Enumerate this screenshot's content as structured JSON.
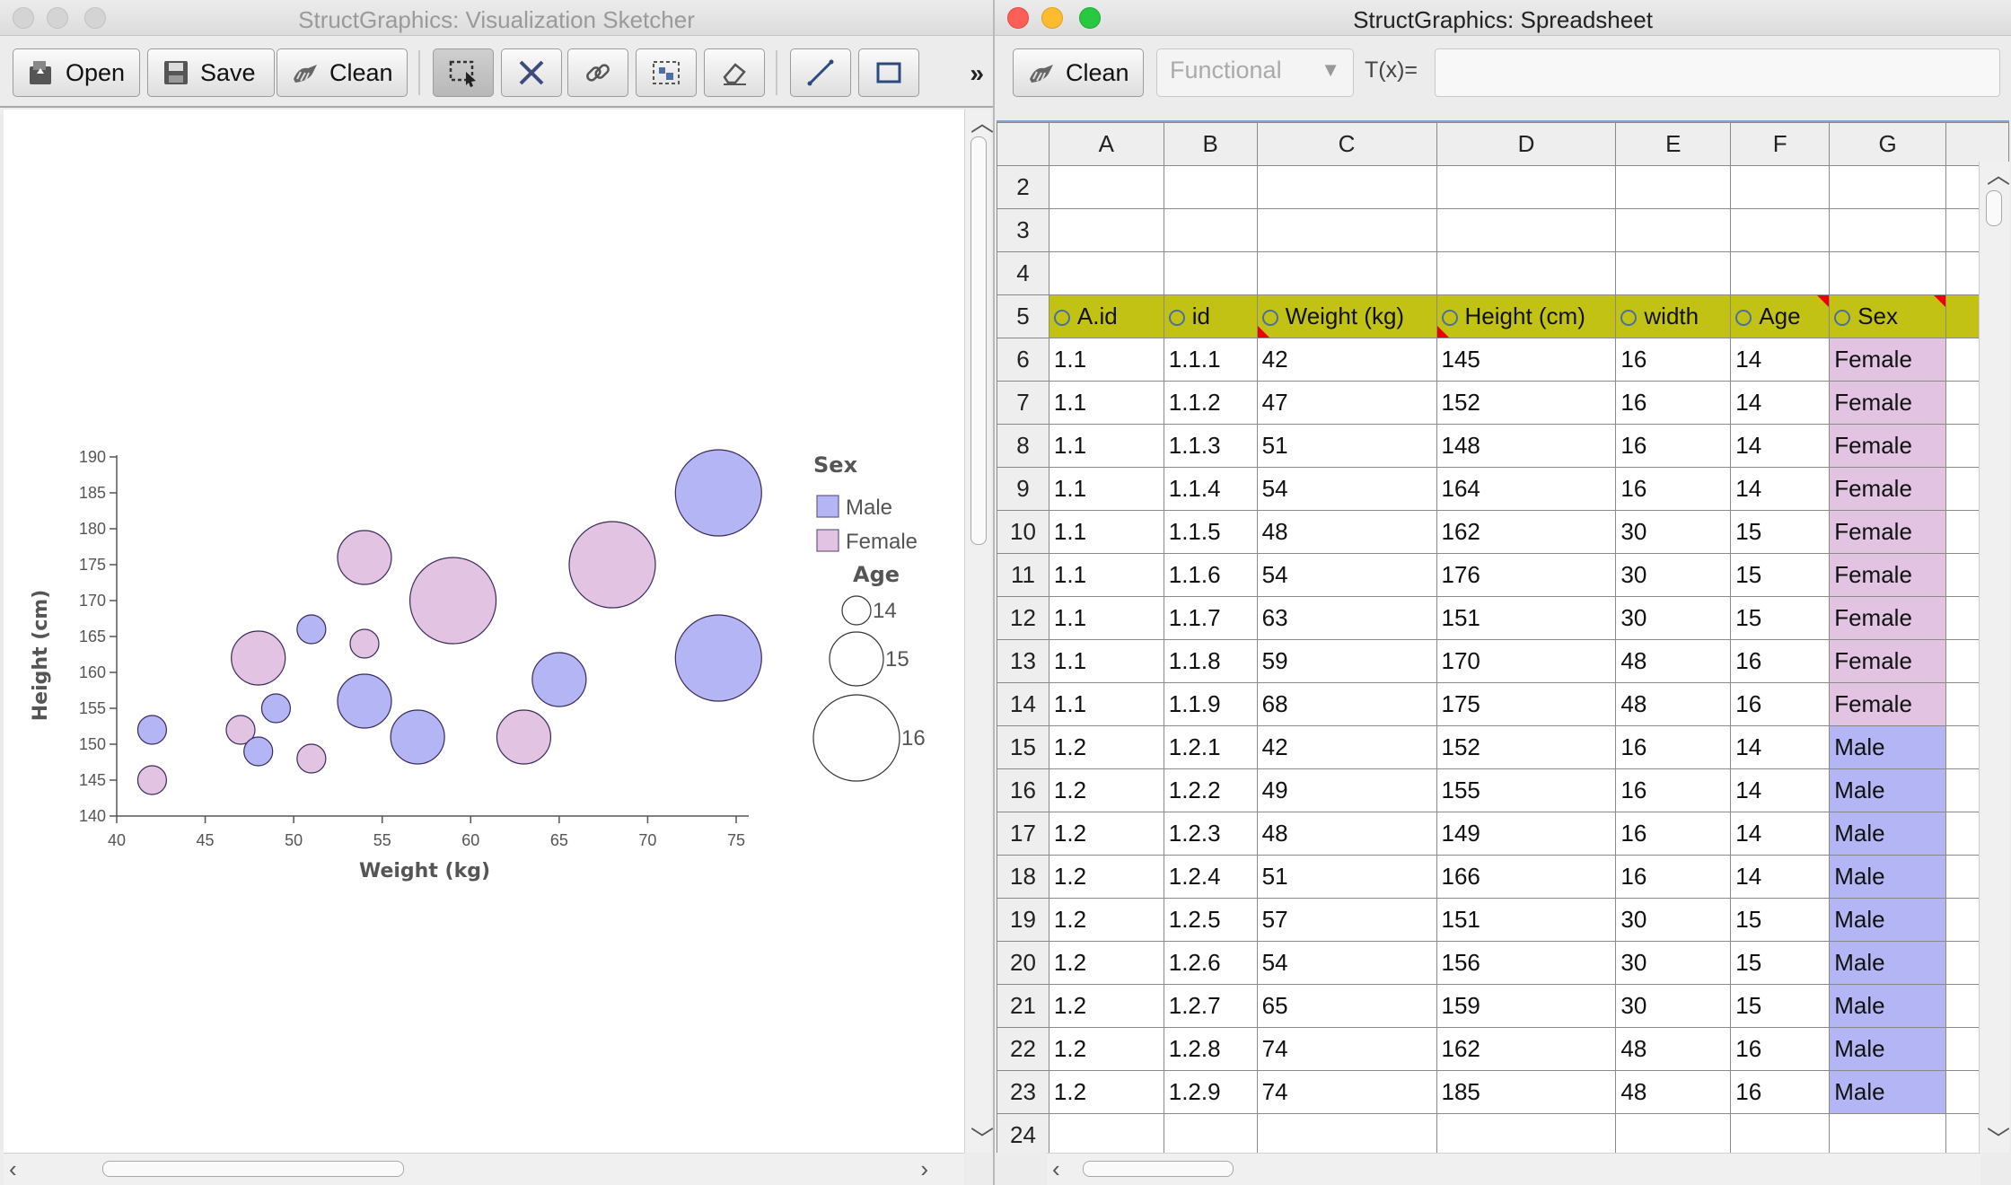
{
  "sketcher": {
    "title": "StructGraphics: Visualization Sketcher",
    "toolbar": {
      "open_label": "Open",
      "save_label": "Save",
      "clean_label": "Clean",
      "tools": [
        "select-tool-icon",
        "delete-cross-icon",
        "link-icon",
        "group-icon",
        "eraser-icon",
        "line-tool-icon",
        "rectangle-tool-icon"
      ],
      "overflow_label": "»"
    }
  },
  "chart_data": {
    "type": "scatter",
    "xlabel": "Weight (kg)",
    "ylabel": "Height (cm)",
    "xlim": [
      40,
      75
    ],
    "ylim": [
      140,
      190
    ],
    "x_ticks": [
      "40",
      "45",
      "50",
      "55",
      "60",
      "65",
      "70",
      "75"
    ],
    "y_ticks": [
      "140",
      "145",
      "150",
      "155",
      "160",
      "165",
      "170",
      "175",
      "180",
      "185",
      "190"
    ],
    "colors": {
      "Female": "#e2c3e2",
      "Male": "#b3b5f5"
    },
    "series": [
      {
        "name": "Female",
        "points": [
          {
            "id": "1.1.1",
            "weight": 42,
            "height": 145,
            "age": 14
          },
          {
            "id": "1.1.2",
            "weight": 47,
            "height": 152,
            "age": 14
          },
          {
            "id": "1.1.3",
            "weight": 51,
            "height": 148,
            "age": 14
          },
          {
            "id": "1.1.4",
            "weight": 54,
            "height": 164,
            "age": 14
          },
          {
            "id": "1.1.5",
            "weight": 48,
            "height": 162,
            "age": 15
          },
          {
            "id": "1.1.6",
            "weight": 54,
            "height": 176,
            "age": 15
          },
          {
            "id": "1.1.7",
            "weight": 63,
            "height": 151,
            "age": 15
          },
          {
            "id": "1.1.8",
            "weight": 59,
            "height": 170,
            "age": 16
          },
          {
            "id": "1.1.9",
            "weight": 68,
            "height": 175,
            "age": 16
          }
        ]
      },
      {
        "name": "Male",
        "points": [
          {
            "id": "1.2.1",
            "weight": 42,
            "height": 152,
            "age": 14
          },
          {
            "id": "1.2.2",
            "weight": 49,
            "height": 155,
            "age": 14
          },
          {
            "id": "1.2.3",
            "weight": 48,
            "height": 149,
            "age": 14
          },
          {
            "id": "1.2.4",
            "weight": 51,
            "height": 166,
            "age": 14
          },
          {
            "id": "1.2.5",
            "weight": 57,
            "height": 151,
            "age": 15
          },
          {
            "id": "1.2.6",
            "weight": 54,
            "height": 156,
            "age": 15
          },
          {
            "id": "1.2.7",
            "weight": 65,
            "height": 159,
            "age": 15
          },
          {
            "id": "1.2.8",
            "weight": 74,
            "height": 162,
            "age": 16
          },
          {
            "id": "1.2.9",
            "weight": 74,
            "height": 185,
            "age": 16
          }
        ]
      }
    ],
    "legend": {
      "color_title": "Sex",
      "color_items": [
        "Male",
        "Female"
      ],
      "size_title": "Age",
      "size_items": [
        "14",
        "15",
        "16"
      ]
    }
  },
  "spreadsheet": {
    "title": "StructGraphics: Spreadsheet",
    "clean_label": "Clean",
    "function_select": "Functional",
    "tx_label": "T(x)=",
    "tx_value": "",
    "column_letters": [
      "A",
      "B",
      "C",
      "D",
      "E",
      "F",
      "G"
    ],
    "headers": [
      "A.id",
      "id",
      "Weight (kg)",
      "Height (cm)",
      "width",
      "Age",
      "Sex"
    ],
    "empty_rows_before": [
      "2",
      "3",
      "4"
    ],
    "header_row_number": "5",
    "rows": [
      {
        "n": "6",
        "cells": [
          "1.1",
          "1.1.1",
          "42",
          "145",
          "16",
          "14",
          "Female"
        ]
      },
      {
        "n": "7",
        "cells": [
          "1.1",
          "1.1.2",
          "47",
          "152",
          "16",
          "14",
          "Female"
        ]
      },
      {
        "n": "8",
        "cells": [
          "1.1",
          "1.1.3",
          "51",
          "148",
          "16",
          "14",
          "Female"
        ]
      },
      {
        "n": "9",
        "cells": [
          "1.1",
          "1.1.4",
          "54",
          "164",
          "16",
          "14",
          "Female"
        ]
      },
      {
        "n": "10",
        "cells": [
          "1.1",
          "1.1.5",
          "48",
          "162",
          "30",
          "15",
          "Female"
        ]
      },
      {
        "n": "11",
        "cells": [
          "1.1",
          "1.1.6",
          "54",
          "176",
          "30",
          "15",
          "Female"
        ]
      },
      {
        "n": "12",
        "cells": [
          "1.1",
          "1.1.7",
          "63",
          "151",
          "30",
          "15",
          "Female"
        ]
      },
      {
        "n": "13",
        "cells": [
          "1.1",
          "1.1.8",
          "59",
          "170",
          "48",
          "16",
          "Female"
        ]
      },
      {
        "n": "14",
        "cells": [
          "1.1",
          "1.1.9",
          "68",
          "175",
          "48",
          "16",
          "Female"
        ]
      },
      {
        "n": "15",
        "cells": [
          "1.2",
          "1.2.1",
          "42",
          "152",
          "16",
          "14",
          "Male"
        ]
      },
      {
        "n": "16",
        "cells": [
          "1.2",
          "1.2.2",
          "49",
          "155",
          "16",
          "14",
          "Male"
        ]
      },
      {
        "n": "17",
        "cells": [
          "1.2",
          "1.2.3",
          "48",
          "149",
          "16",
          "14",
          "Male"
        ]
      },
      {
        "n": "18",
        "cells": [
          "1.2",
          "1.2.4",
          "51",
          "166",
          "16",
          "14",
          "Male"
        ]
      },
      {
        "n": "19",
        "cells": [
          "1.2",
          "1.2.5",
          "57",
          "151",
          "30",
          "15",
          "Male"
        ]
      },
      {
        "n": "20",
        "cells": [
          "1.2",
          "1.2.6",
          "54",
          "156",
          "30",
          "15",
          "Male"
        ]
      },
      {
        "n": "21",
        "cells": [
          "1.2",
          "1.2.7",
          "65",
          "159",
          "30",
          "15",
          "Male"
        ]
      },
      {
        "n": "22",
        "cells": [
          "1.2",
          "1.2.8",
          "74",
          "162",
          "48",
          "16",
          "Male"
        ]
      },
      {
        "n": "23",
        "cells": [
          "1.2",
          "1.2.9",
          "74",
          "185",
          "48",
          "16",
          "Male"
        ]
      }
    ],
    "empty_rows_after": [
      "24"
    ]
  }
}
